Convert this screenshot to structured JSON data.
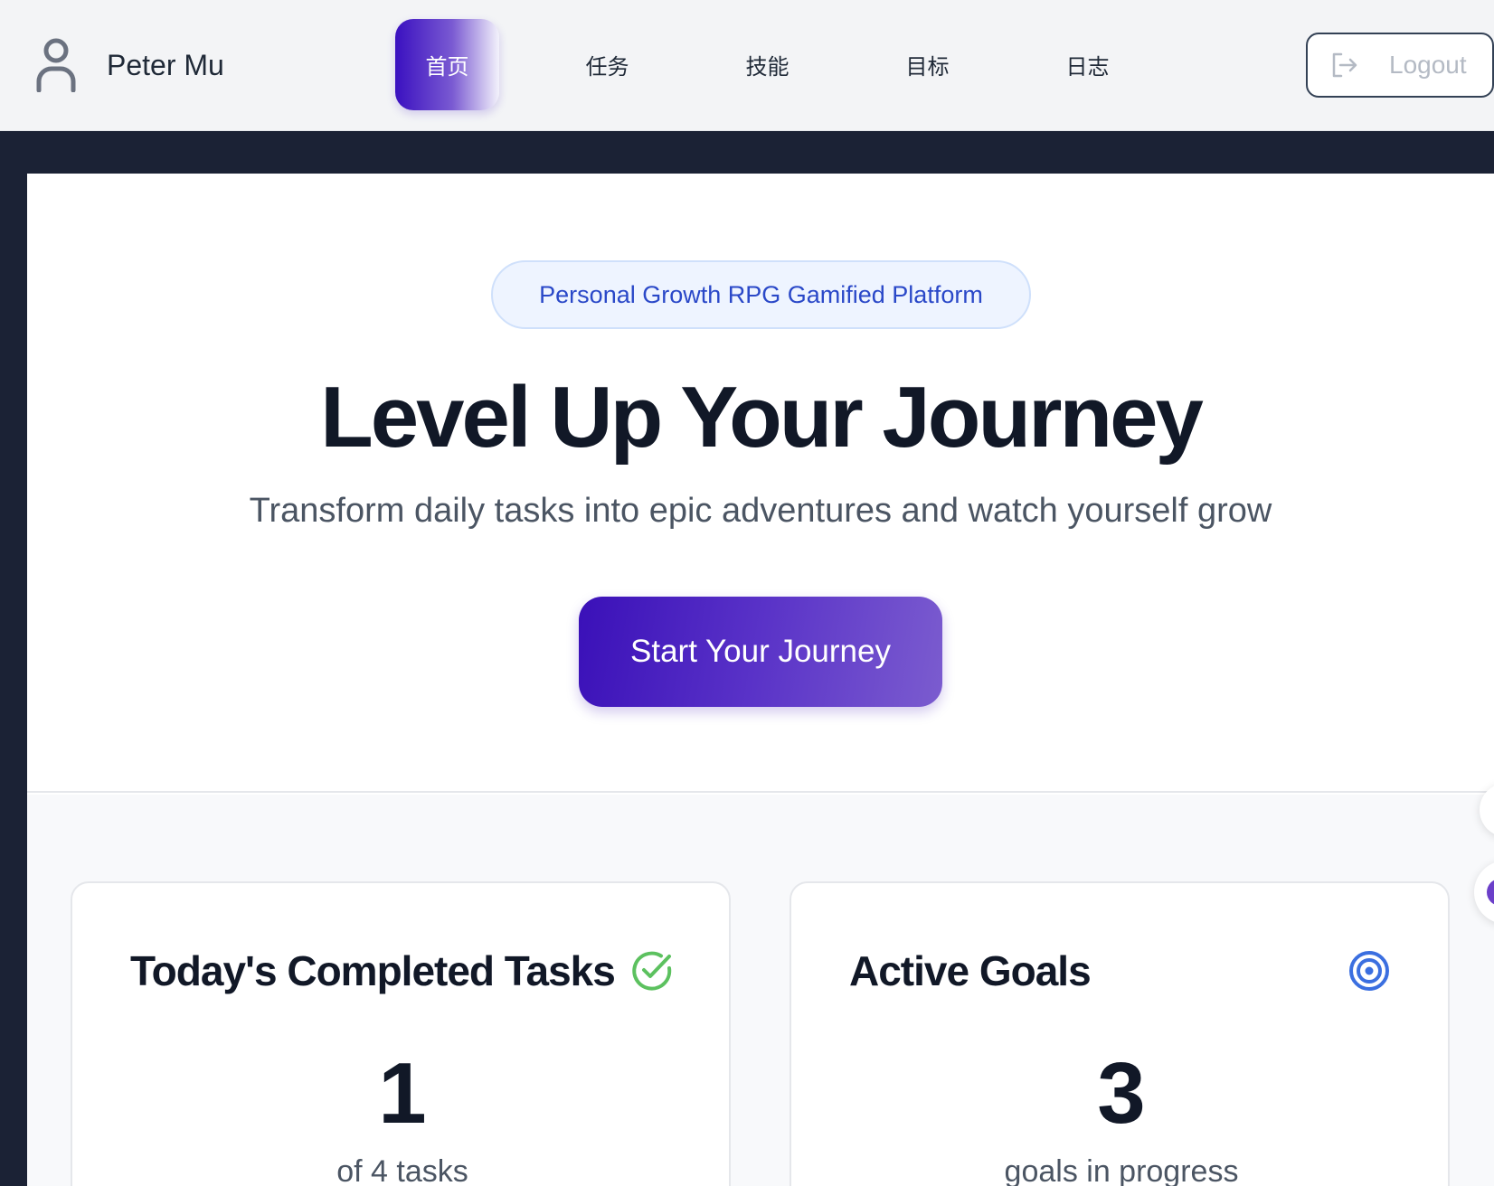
{
  "header": {
    "user_name": "Peter Mu",
    "user_icon": "user-icon",
    "nav": [
      {
        "label": "首页",
        "active": true
      },
      {
        "label": "任务",
        "active": false
      },
      {
        "label": "技能",
        "active": false
      },
      {
        "label": "目标",
        "active": false
      },
      {
        "label": "日志",
        "active": false
      }
    ],
    "logout_label": "Logout",
    "logout_icon": "logout-icon"
  },
  "hero": {
    "badge": "Personal Growth RPG Gamified Platform",
    "title": "Level Up Your Journey",
    "subtitle": "Transform daily tasks into epic adventures and watch yourself grow",
    "cta_label": "Start Your Journey"
  },
  "stats": [
    {
      "title": "Today's Completed Tasks",
      "icon": "check-circle-icon",
      "value": "1",
      "caption": "of 4 tasks",
      "accent": "#5cc15f"
    },
    {
      "title": "Active Goals",
      "icon": "target-icon",
      "value": "3",
      "caption": "goals in progress",
      "accent": "#3b6fe0"
    }
  ],
  "colors": {
    "brand_gradient_start": "#3a10c0",
    "brand_gradient_end": "#7b5ccf",
    "frame_dark": "#1b2235",
    "badge_text": "#2a48c8"
  }
}
